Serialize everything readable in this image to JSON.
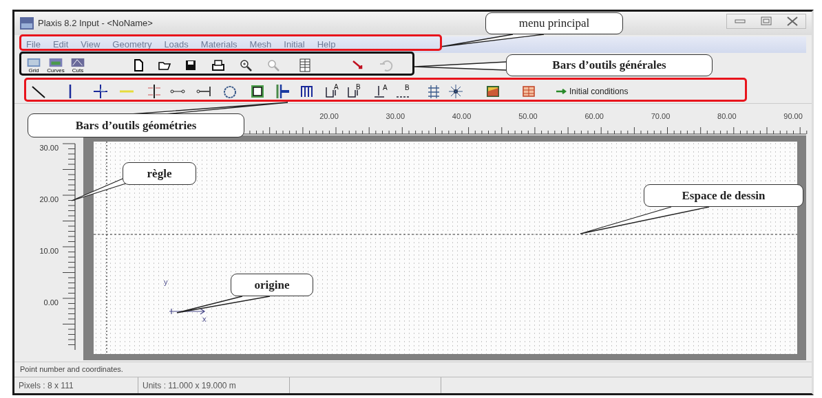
{
  "window": {
    "title": "Plaxis 8.2 Input - <NoName>"
  },
  "menu": {
    "items": [
      "File",
      "Edit",
      "View",
      "Geometry",
      "Loads",
      "Materials",
      "Mesh",
      "Initial",
      "Help"
    ]
  },
  "general_toolbar": {
    "view_buttons": [
      "Grid",
      "Curves",
      "Cuts"
    ]
  },
  "geometry_toolbar": {
    "tool_letters": [
      "A",
      "B",
      "A",
      "B"
    ],
    "initial_button": "Initial conditions"
  },
  "ruler_x": {
    "labels": [
      "20.00",
      "30.00",
      "40.00",
      "50.00",
      "60.00",
      "70.00",
      "80.00",
      "90.00"
    ]
  },
  "ruler_y": {
    "labels": [
      "30.00",
      "20.00",
      "10.00",
      "0.00"
    ]
  },
  "drawing_area": {
    "axis_labels": [
      "y",
      "x"
    ]
  },
  "status_bar": {
    "message": "Point number and coordinates.",
    "pixels": "Pixels : 8 x 111",
    "units": "Units  :  11.000 x 19.000 m"
  },
  "frames": [
    {
      "color": "#e8141c"
    },
    {
      "color": "#111111"
    },
    {
      "color": "#e8141c"
    }
  ],
  "callouts": [
    {
      "text": "menu principal",
      "bold": false
    },
    {
      "text": "Bars d’outils générales",
      "bold": true
    },
    {
      "text": "Bars d’outils géométries",
      "bold": true
    },
    {
      "text": "règle",
      "bold": true
    },
    {
      "text": "Espace de dessin",
      "bold": true
    },
    {
      "text": "origine",
      "bold": true
    }
  ]
}
